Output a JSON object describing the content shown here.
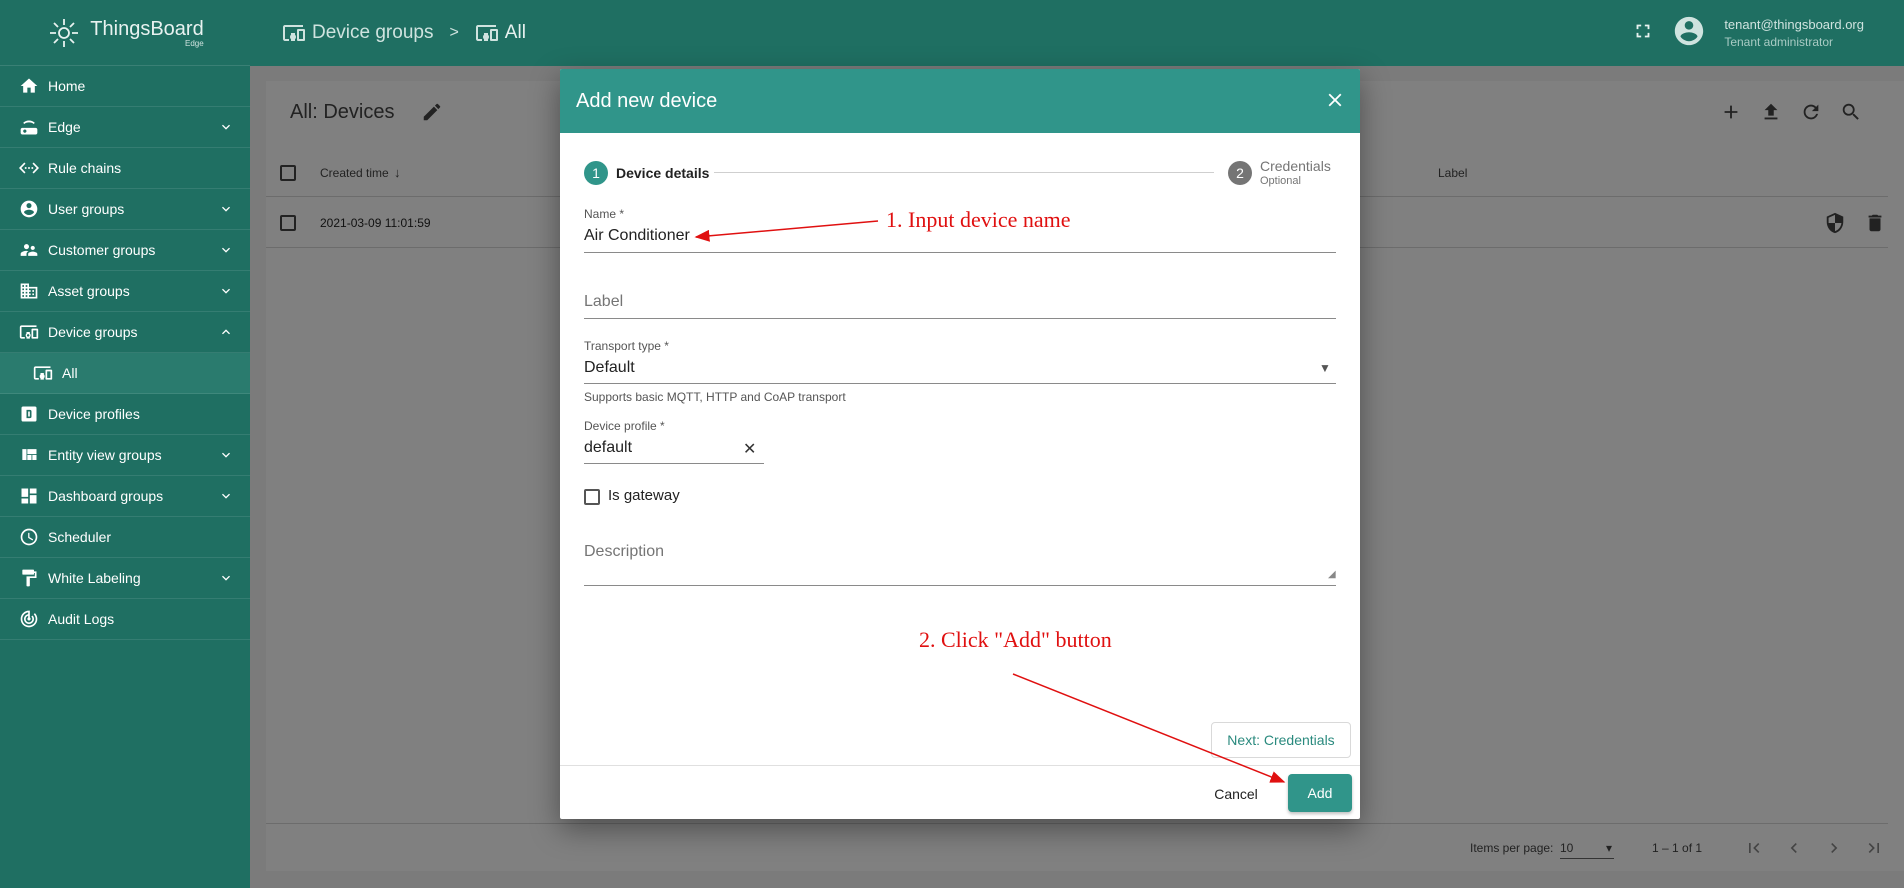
{
  "app": {
    "name": "ThingsBoard",
    "edition": "Edge"
  },
  "sidebar": {
    "items": [
      {
        "label": "Home",
        "icon": "home-icon",
        "expandable": false
      },
      {
        "label": "Edge",
        "icon": "router-icon",
        "expandable": true
      },
      {
        "label": "Rule chains",
        "icon": "settings-ethernet-icon",
        "expandable": false
      },
      {
        "label": "User groups",
        "icon": "account-circle-icon",
        "expandable": true
      },
      {
        "label": "Customer groups",
        "icon": "supervisor-account-icon",
        "expandable": true
      },
      {
        "label": "Asset groups",
        "icon": "domain-icon",
        "expandable": true
      },
      {
        "label": "Device groups",
        "icon": "devices-other-icon",
        "expandable": true,
        "expanded": true
      },
      {
        "label": "All",
        "icon": "devices-other-icon",
        "expandable": false,
        "sub": true
      },
      {
        "label": "Device profiles",
        "icon": "mdi-alpha-d-box-icon",
        "expandable": false
      },
      {
        "label": "Entity view groups",
        "icon": "view-quilt-icon",
        "expandable": true
      },
      {
        "label": "Dashboard groups",
        "icon": "dashboard-icon",
        "expandable": true
      },
      {
        "label": "Scheduler",
        "icon": "schedule-icon",
        "expandable": false
      },
      {
        "label": "White Labeling",
        "icon": "format-paint-icon",
        "expandable": true
      },
      {
        "label": "Audit Logs",
        "icon": "track-changes-icon",
        "expandable": false
      }
    ]
  },
  "topbar": {
    "breadcrumb": [
      "Device groups",
      "All"
    ],
    "separator": ">",
    "user_email": "tenant@thingsboard.org",
    "user_role": "Tenant administrator"
  },
  "table": {
    "title": "All: Devices",
    "columns": [
      "Created time",
      "Label"
    ],
    "rows": [
      {
        "created": "2021-03-09 11:01:59"
      }
    ],
    "items_per_page_label": "Items per page:",
    "items_per_page": "10",
    "range": "1 – 1 of 1"
  },
  "dialog": {
    "title": "Add new device",
    "steps": [
      {
        "num": "1",
        "label": "Device details",
        "active": true
      },
      {
        "num": "2",
        "label": "Credentials",
        "sub": "Optional",
        "active": false
      }
    ],
    "name_label": "Name *",
    "name_value": "Air Conditioner",
    "label_placeholder": "Label",
    "transport_label": "Transport type *",
    "transport_value": "Default",
    "transport_hint": "Supports basic MQTT, HTTP and CoAP transport",
    "profile_label": "Device profile *",
    "profile_value": "default",
    "gateway_label": "Is gateway",
    "description_placeholder": "Description",
    "next_button": "Next: Credentials",
    "cancel_button": "Cancel",
    "add_button": "Add"
  },
  "annotations": {
    "step1": "1. Input device name",
    "step2": "2. Click \"Add\" button",
    "color": "#e01010"
  },
  "colors": {
    "primary": "#1f6f62",
    "accent": "#30958a"
  }
}
